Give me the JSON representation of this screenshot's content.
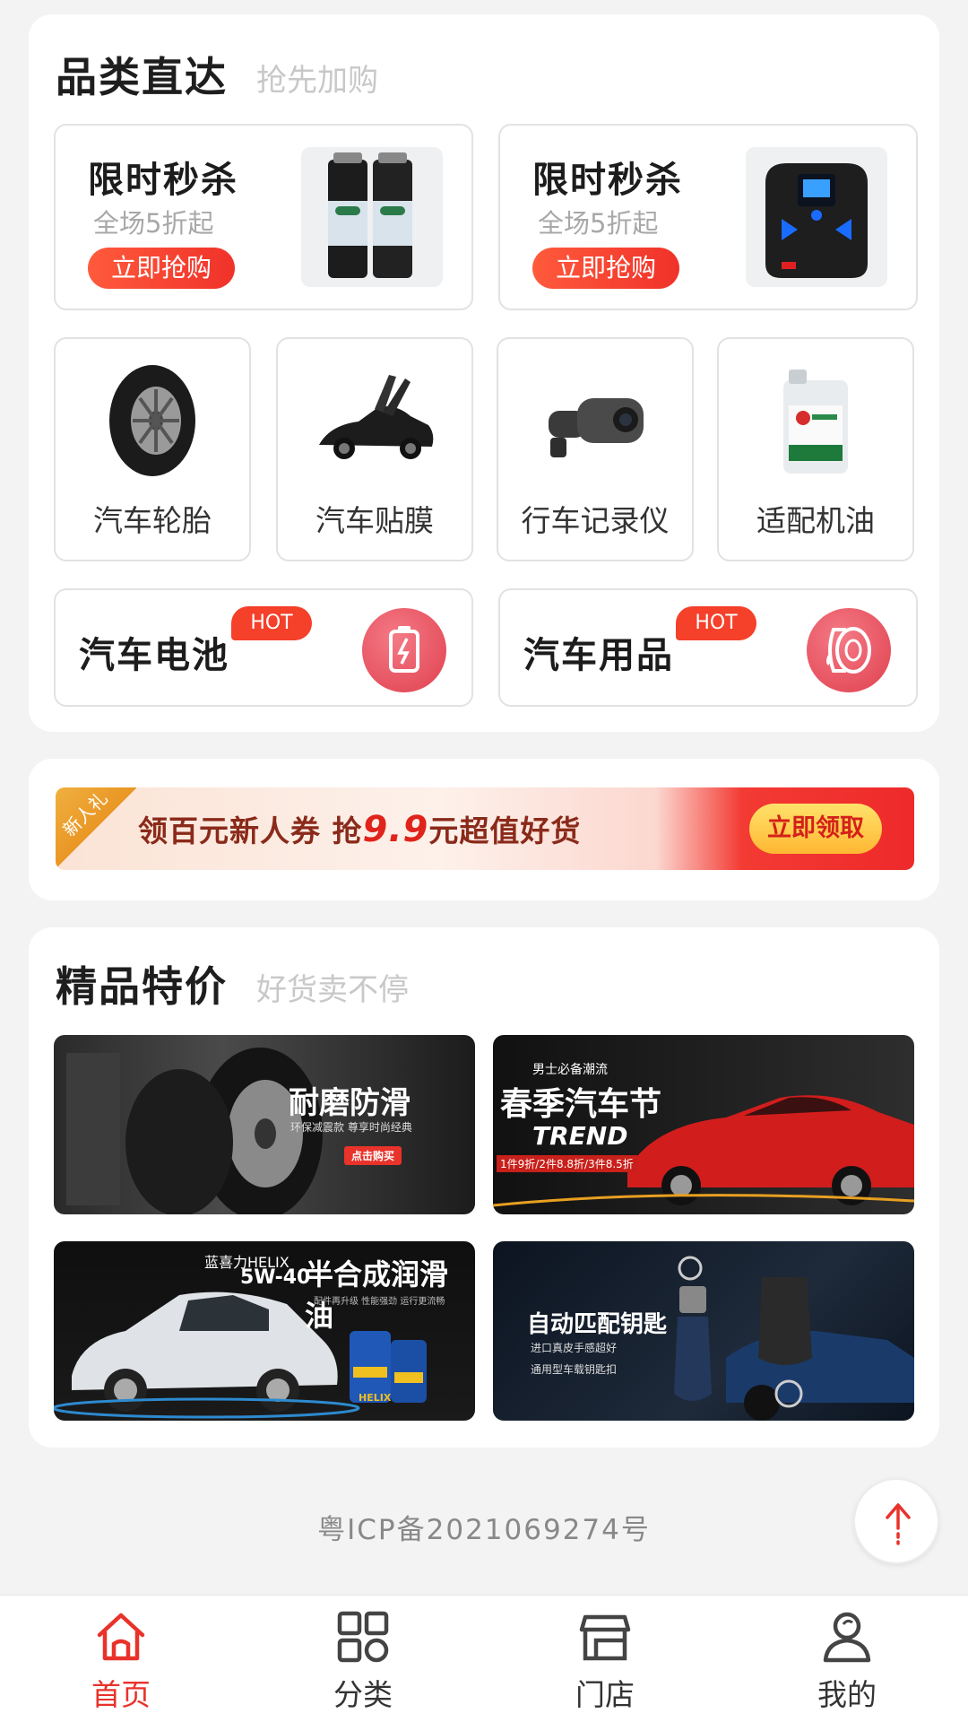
{
  "category_section": {
    "title": "品类直达",
    "subtitle": "抢先加购",
    "flash_sales": [
      {
        "title": "限时秒杀",
        "subtitle": "全场5折起",
        "button": "立即抢购",
        "image": "spray-cans"
      },
      {
        "title": "限时秒杀",
        "subtitle": "全场5折起",
        "button": "立即抢购",
        "image": "air-pump"
      }
    ],
    "categories": [
      {
        "label": "汽车轮胎",
        "image": "tire"
      },
      {
        "label": "汽车贴膜",
        "image": "sports-car"
      },
      {
        "label": "行车记录仪",
        "image": "dash-cam"
      },
      {
        "label": "适配机油",
        "image": "oil-bottle"
      }
    ],
    "hot_items": [
      {
        "label": "汽车电池",
        "badge": "HOT",
        "icon": "battery-icon"
      },
      {
        "label": "汽车用品",
        "badge": "HOT",
        "icon": "tire-roll-icon"
      }
    ]
  },
  "coupon_banner": {
    "tag": "新人礼",
    "text_before": "领百元新人券 抢",
    "highlight": "9.9",
    "text_after": "元超值好货",
    "button": "立即领取"
  },
  "special_section": {
    "title": "精品特价",
    "subtitle": "好货卖不停",
    "promos": [
      {
        "headline": "耐磨防滑",
        "line1": "环保减震款 尊享时尚经典",
        "cta": "点击购买"
      },
      {
        "kicker": "男士必备潮流",
        "headline": "春季汽车节",
        "line1": "TREND",
        "line2": "1件9折/2件8.8折/3件8.5折"
      },
      {
        "kicker": "蓝喜力HELIX",
        "headline": "半合成润滑油",
        "line1": "5W-40",
        "line2": "配件再升级 性能强劲 运行更流畅",
        "tag": "HELIX"
      },
      {
        "headline": "自动匹配钥匙",
        "line1": "进口真皮手感超好",
        "line2": "通用型车载钥匙扣"
      }
    ]
  },
  "footer": {
    "icp": "粤ICP备2021069274号"
  },
  "tabbar": {
    "tabs": [
      {
        "label": "首页",
        "icon": "home-icon",
        "active": true
      },
      {
        "label": "分类",
        "icon": "grid-icon",
        "active": false
      },
      {
        "label": "门店",
        "icon": "store-icon",
        "active": false
      },
      {
        "label": "我的",
        "icon": "user-icon",
        "active": false
      }
    ]
  },
  "colors": {
    "accent": "#e8322a",
    "badge": "#f5402a",
    "background": "#f3f3f3"
  }
}
